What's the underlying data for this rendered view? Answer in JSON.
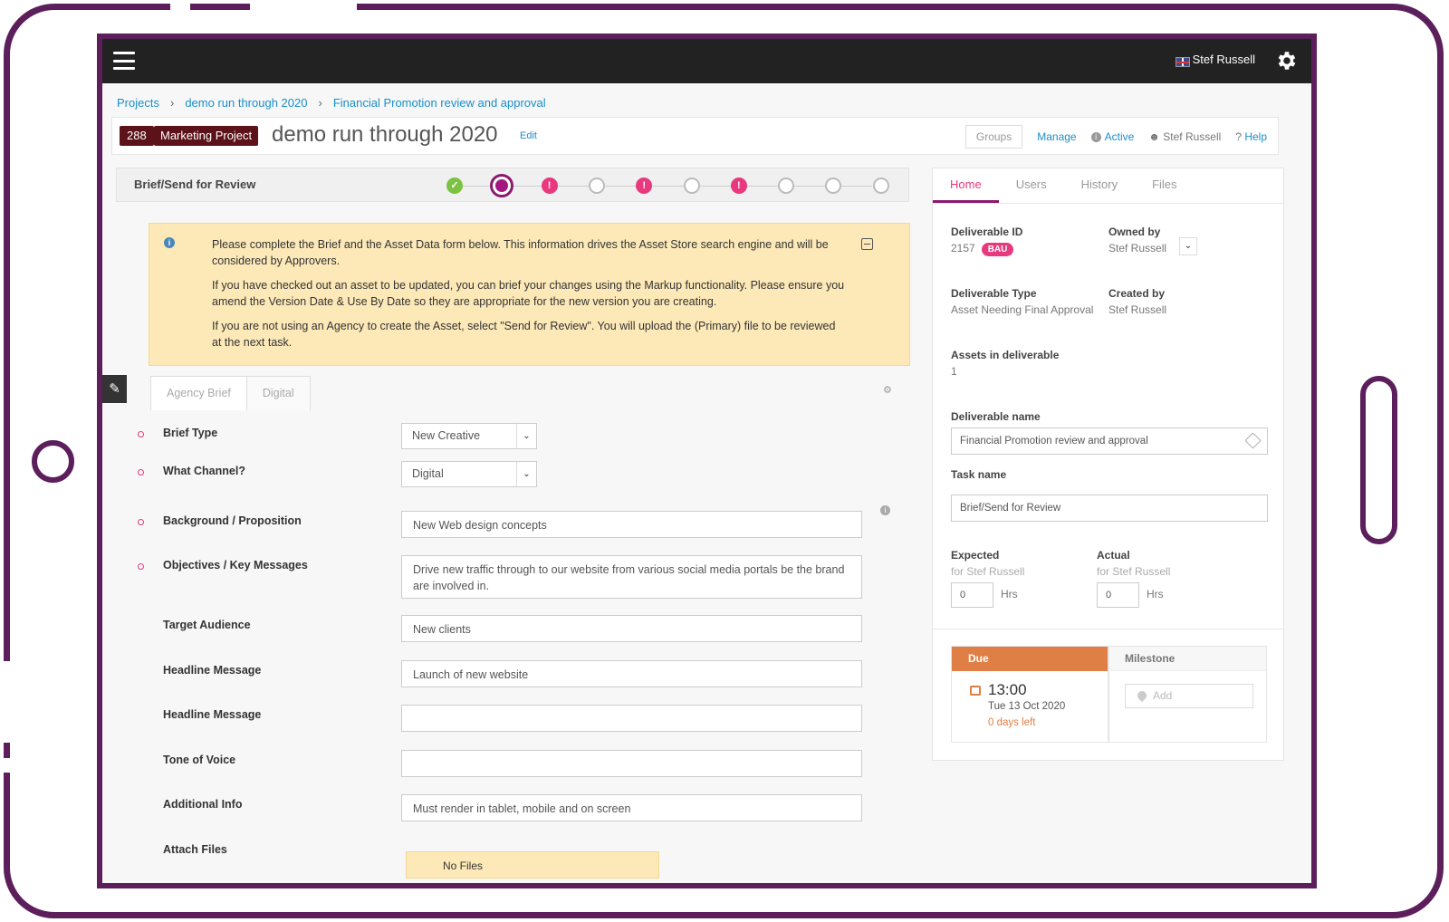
{
  "topbar": {
    "user": "Stef Russell"
  },
  "breadcrumb": [
    "Projects",
    "demo run through 2020",
    "Financial Promotion review and approval"
  ],
  "project": {
    "number": "288",
    "type": "Marketing Project",
    "title": "demo run through 2020",
    "edit_label": "Edit"
  },
  "header_actions": {
    "groups": "Groups",
    "manage": "Manage",
    "status": "Active",
    "owner": "Stef Russell",
    "help": "Help"
  },
  "workflow": {
    "step_title": "Brief/Send for Review",
    "steps": [
      "complete",
      "current",
      "warning",
      "pending",
      "warning",
      "pending",
      "warning",
      "pending",
      "pending",
      "pending"
    ]
  },
  "alert": {
    "p1": "Please complete the Brief and the Asset Data form below. This information drives the Asset Store search engine and will be considered by Approvers.",
    "p2": "If you have checked out an asset to be updated, you can brief your changes using the Markup functionality. Please ensure you amend the Version Date & Use By Date so they are appropriate for the new version you are creating.",
    "p3": "If you are not using an Agency to create the Asset, select \"Send for Review\". You will upload the (Primary) file to be reviewed at the next task."
  },
  "form_tabs": [
    "Agency Brief",
    "Digital"
  ],
  "form": {
    "brief_type": {
      "label": "Brief Type",
      "value": "New Creative"
    },
    "channel": {
      "label": "What Channel?",
      "value": "Digital"
    },
    "background": {
      "label": "Background / Proposition",
      "value": "New Web design concepts"
    },
    "objectives": {
      "label": "Objectives / Key Messages",
      "value": "Drive new traffic through to our website from various social media portals be the brand are involved in."
    },
    "audience": {
      "label": "Target Audience",
      "value": "New clients"
    },
    "headline1": {
      "label": "Headline Message",
      "value": "Launch of new website"
    },
    "headline2": {
      "label": "Headline Message",
      "value": ""
    },
    "tone": {
      "label": "Tone of Voice",
      "value": ""
    },
    "additional": {
      "label": "Additional Info",
      "value": "Must render in tablet, mobile and on screen"
    },
    "attach": {
      "label": "Attach Files",
      "nofile": "No Files"
    }
  },
  "right_tabs": [
    "Home",
    "Users",
    "History",
    "Files"
  ],
  "details": {
    "deliverable_id_label": "Deliverable ID",
    "deliverable_id": "2157",
    "bau": "BAU",
    "owned_by_label": "Owned by",
    "owned_by": "Stef Russell",
    "type_label": "Deliverable Type",
    "type": "Asset Needing Final Approval",
    "created_by_label": "Created by",
    "created_by": "Stef Russell",
    "assets_label": "Assets in deliverable",
    "assets": "1",
    "name_label": "Deliverable name",
    "name": "Financial Promotion review and approval",
    "task_label": "Task name",
    "task": "Brief/Send for Review",
    "expected_label": "Expected",
    "expected_for": "for Stef Russell",
    "expected_hrs": "0",
    "actual_label": "Actual",
    "actual_for": "for Stef Russell",
    "actual_hrs": "0",
    "hrs": "Hrs"
  },
  "due": {
    "label": "Due",
    "time": "13:00",
    "date": "Tue 13 Oct 2020",
    "left": "0 days left"
  },
  "milestone": {
    "label": "Milestone",
    "add": "Add"
  },
  "colors": {
    "frame": "#5c1f5c",
    "accent": "#e8397f",
    "link": "#1a8fc9",
    "due": "#e07f45",
    "badge": "#5b1218"
  }
}
